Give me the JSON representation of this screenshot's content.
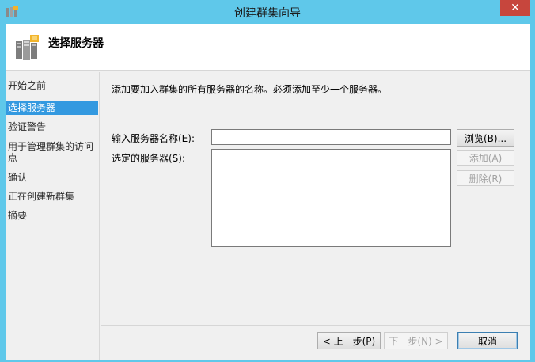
{
  "window": {
    "title": "创建群集向导",
    "close_glyph": "✕"
  },
  "header": {
    "title": "选择服务器"
  },
  "nav": {
    "items": [
      {
        "label": "开始之前"
      },
      {
        "label": "选择服务器"
      },
      {
        "label": "验证警告"
      },
      {
        "label": "用于管理群集的访问"
      },
      {
        "label": "点"
      },
      {
        "label": "确认"
      },
      {
        "label": "正在创建新群集"
      },
      {
        "label": "摘要"
      }
    ]
  },
  "main": {
    "description": "添加要加入群集的所有服务器的名称。必须添加至少一个服务器。",
    "server_name_label": "输入服务器名称(E):",
    "server_name_value": "",
    "selected_servers_label": "选定的服务器(S):",
    "browse_label": "浏览(B)...",
    "add_label": "添加(A)",
    "remove_label": "删除(R)"
  },
  "footer": {
    "prev_label": "< 上一步(P)",
    "next_label": "下一步(N) >",
    "cancel_label": "取消"
  },
  "colors": {
    "titlebar": "#5fc8ea",
    "close": "#c7463d",
    "nav_active": "#3399e0"
  },
  "icons": {
    "app": "cluster-icon",
    "header": "server-cluster-icon"
  }
}
